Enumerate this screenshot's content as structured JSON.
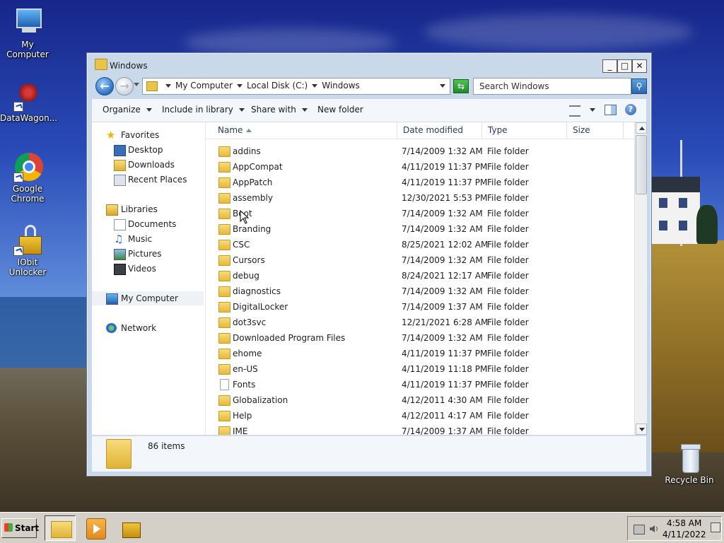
{
  "desktop": {
    "icons": [
      {
        "label": "My Computer"
      },
      {
        "label": "DataWagon..."
      },
      {
        "label": "Google Chrome"
      },
      {
        "label": "IObit Unlocker"
      },
      {
        "label": "Recycle Bin"
      }
    ]
  },
  "window": {
    "title": "Windows",
    "controls": {
      "minimize": "_",
      "maximize": "□",
      "close": "✕"
    }
  },
  "address": {
    "crumbs": [
      "My Computer",
      "Local Disk (C:)",
      "Windows"
    ],
    "search_placeholder": "Search Windows"
  },
  "commandbar": {
    "organize": "Organize",
    "include": "Include in library",
    "share": "Share with",
    "new_folder": "New folder"
  },
  "navpane": {
    "favorites": "Favorites",
    "desktop": "Desktop",
    "downloads": "Downloads",
    "recent": "Recent Places",
    "libraries": "Libraries",
    "documents": "Documents",
    "music": "Music",
    "pictures": "Pictures",
    "videos": "Videos",
    "computer": "My Computer",
    "network": "Network"
  },
  "columns": {
    "name": "Name",
    "date": "Date modified",
    "type": "Type",
    "size": "Size"
  },
  "files": [
    {
      "name": "addins",
      "date": "7/14/2009 1:32 AM",
      "type": "File folder"
    },
    {
      "name": "AppCompat",
      "date": "4/11/2019 11:37 PM",
      "type": "File folder"
    },
    {
      "name": "AppPatch",
      "date": "4/11/2019 11:37 PM",
      "type": "File folder"
    },
    {
      "name": "assembly",
      "date": "12/30/2021 5:53 PM",
      "type": "File folder"
    },
    {
      "name": "Boot",
      "date": "7/14/2009 1:32 AM",
      "type": "File folder"
    },
    {
      "name": "Branding",
      "date": "7/14/2009 1:32 AM",
      "type": "File folder"
    },
    {
      "name": "CSC",
      "date": "8/25/2021 12:02 AM",
      "type": "File folder"
    },
    {
      "name": "Cursors",
      "date": "7/14/2009 1:32 AM",
      "type": "File folder"
    },
    {
      "name": "debug",
      "date": "8/24/2021 12:17 AM",
      "type": "File folder"
    },
    {
      "name": "diagnostics",
      "date": "7/14/2009 1:32 AM",
      "type": "File folder"
    },
    {
      "name": "DigitalLocker",
      "date": "7/14/2009 1:37 AM",
      "type": "File folder"
    },
    {
      "name": "dot3svc",
      "date": "12/21/2021 6:28 AM",
      "type": "File folder"
    },
    {
      "name": "Downloaded Program Files",
      "date": "7/14/2009 1:32 AM",
      "type": "File folder"
    },
    {
      "name": "ehome",
      "date": "4/11/2019 11:37 PM",
      "type": "File folder"
    },
    {
      "name": "en-US",
      "date": "4/11/2019 11:18 PM",
      "type": "File folder"
    },
    {
      "name": "Fonts",
      "date": "4/11/2019 11:37 PM",
      "type": "File folder",
      "icon": "doc"
    },
    {
      "name": "Globalization",
      "date": "4/12/2011 4:30 AM",
      "type": "File folder"
    },
    {
      "name": "Help",
      "date": "4/12/2011 4:17 AM",
      "type": "File folder"
    },
    {
      "name": "IME",
      "date": "7/14/2009 1:37 AM",
      "type": "File folder"
    }
  ],
  "status": {
    "item_count": "86 items"
  },
  "taskbar": {
    "start": "Start",
    "time": "4:58 AM",
    "date": "4/11/2022"
  }
}
